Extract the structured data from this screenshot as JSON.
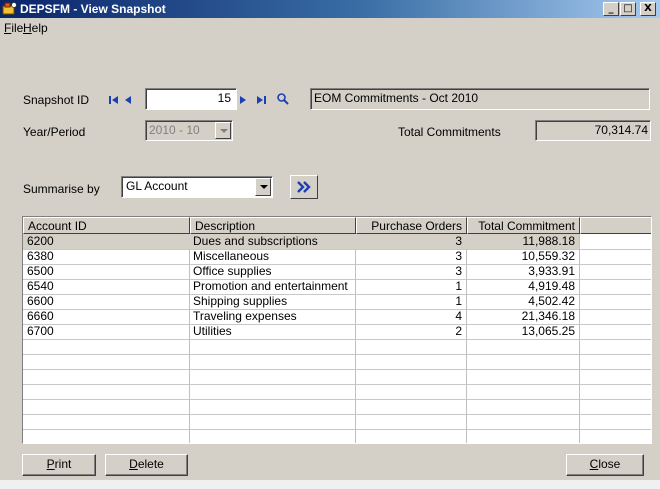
{
  "window": {
    "title": "DEPSFM - View Snapshot",
    "controls": [
      "_",
      "□",
      "X"
    ]
  },
  "menu": {
    "file": {
      "accel": "F",
      "rest": "ile"
    },
    "help": {
      "accel": "H",
      "rest": "elp"
    }
  },
  "snapshot": {
    "label": "Snapshot ID",
    "id_value": "15",
    "description": "EOM Commitments - Oct 2010",
    "nav_icons": [
      "first-record-icon",
      "previous-record-icon",
      "next-record-icon",
      "last-record-icon",
      "lookup-icon"
    ]
  },
  "period": {
    "label": "Year/Period",
    "value": "2010 - 10"
  },
  "totals": {
    "label": "Total Commitments",
    "value": "70,314.74"
  },
  "summarise": {
    "label": "Summarise by",
    "value": "GL Account"
  },
  "grid": {
    "columns": [
      "Account ID",
      "Description",
      "Purchase Orders",
      "Total Commitment"
    ],
    "rows": [
      {
        "account": "6200",
        "description": "Dues and subscriptions",
        "orders": "3",
        "total": "11,988.18"
      },
      {
        "account": "6380",
        "description": "Miscellaneous",
        "orders": "3",
        "total": "10,559.32"
      },
      {
        "account": "6500",
        "description": "Office supplies",
        "orders": "3",
        "total": "3,933.91"
      },
      {
        "account": "6540",
        "description": "Promotion and entertainment",
        "orders": "1",
        "total": "4,919.48"
      },
      {
        "account": "6600",
        "description": "Shipping supplies",
        "orders": "1",
        "total": "4,502.42"
      },
      {
        "account": "6660",
        "description": "Traveling expenses",
        "orders": "4",
        "total": "21,346.18"
      },
      {
        "account": "6700",
        "description": "Utilities",
        "orders": "2",
        "total": "13,065.25"
      }
    ]
  },
  "buttons": {
    "print": {
      "accel": "P",
      "rest": "rint"
    },
    "delete": {
      "accel": "D",
      "rest": "elete"
    },
    "close": {
      "accel": "C",
      "rest": "lose"
    }
  },
  "colors": {
    "title_gradient_start": "#0a246a",
    "title_gradient_end": "#a6caf0",
    "face": "#d4d0c8",
    "nav_icon": "#1c3fb4"
  }
}
